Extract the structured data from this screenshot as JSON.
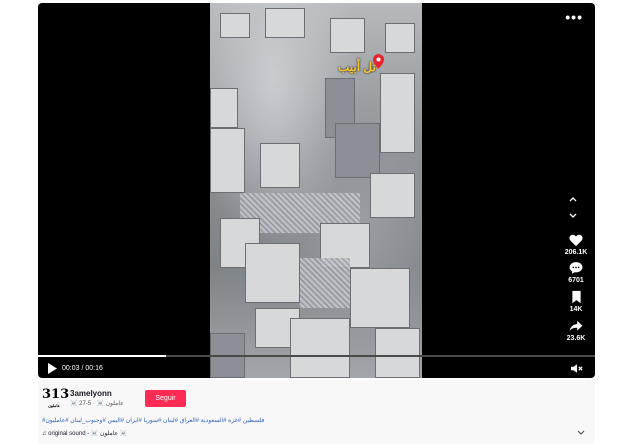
{
  "video": {
    "overlay_text": "تل أبيب",
    "more_label": "•••",
    "current_time": "00:03",
    "duration": "00:16",
    "time_separator": " / ",
    "progress": 0.23
  },
  "sidebar": {
    "likes": "206.1K",
    "comments": "6701",
    "saves": "14K",
    "shares": "23.6K",
    "icons": [
      "heart-icon",
      "comment-icon",
      "bookmark-icon",
      "share-icon"
    ]
  },
  "post": {
    "avatar_text": "313",
    "avatar_sub": "عاملون",
    "username": "3amelyonn",
    "meta": "☠️ عاملون ☠️ · 5-27",
    "follow_label": "Seguir",
    "hashtags": "#فلسطين #غزة #السعودية #العراق #لبنان #سوريا #ايران #اليمن #وجنوب_لبنان #عامليون",
    "sound": "♫ original sound - ☠️ عاملون ☠️"
  },
  "colors": {
    "accent": "#fe2c55",
    "overlay_text": "#f6c531",
    "hashtag": "#2b5db9"
  }
}
